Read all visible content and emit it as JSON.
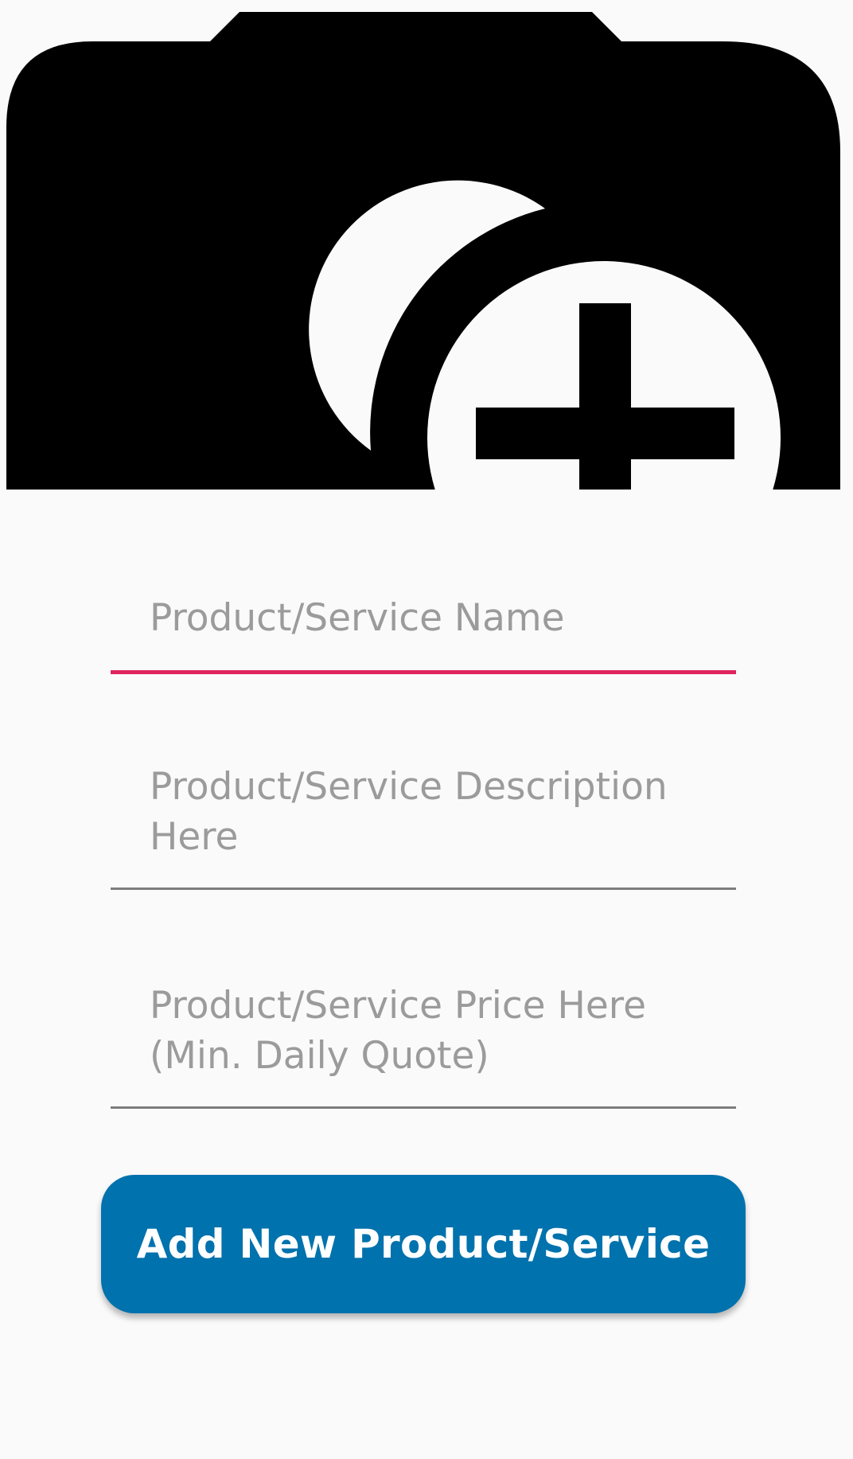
{
  "photo_picker": {
    "icon": "add-a-photo-icon",
    "color": "#000000"
  },
  "form": {
    "name_field": {
      "placeholder": "Product/Service Name",
      "value": "",
      "focused": true
    },
    "description_field": {
      "placeholder": "Product/Service Description\nHere",
      "value": ""
    },
    "price_field": {
      "placeholder": "Product/Service Price Here\n(Min. Daily Quote)",
      "value": ""
    }
  },
  "actions": {
    "add_button_label": "Add New Product/Service"
  },
  "colors": {
    "accent_focus": "#e0245e",
    "button_primary": "#0072ad",
    "placeholder_text": "#9b9b9b",
    "background": "#fafafa"
  }
}
